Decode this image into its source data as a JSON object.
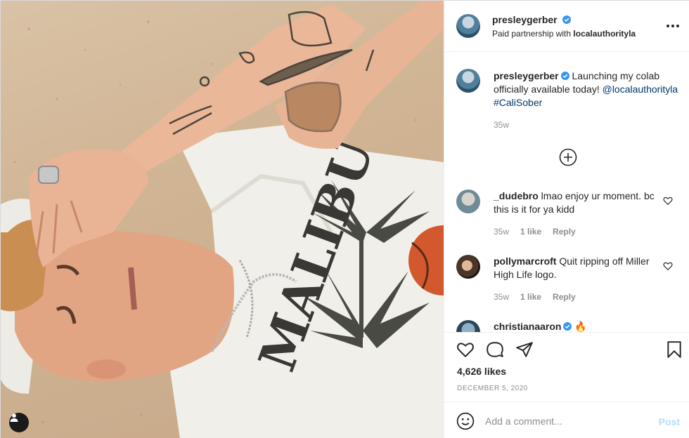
{
  "post": {
    "username": "presleygerber",
    "partnership_prefix": "Paid partnership with",
    "partner": "localauthorityla",
    "caption_text": "Launching my colab officially available today!",
    "caption_mention": "@localauthorityla",
    "caption_hashtag": "#CaliSober",
    "caption_time": "35w",
    "likes": "4,626 likes",
    "date": "DECEMBER 5, 2020",
    "shirt_print": "MALIBU"
  },
  "comments": [
    {
      "username": "_dudebro",
      "text": "lmao enjoy ur moment. bc this is it for ya kidd",
      "time": "35w",
      "likes": "1 like",
      "reply": "Reply"
    },
    {
      "username": "pollymarcroft",
      "text": "Quit ripping off Miller High Life logo.",
      "time": "35w",
      "likes": "1 like",
      "reply": "Reply"
    },
    {
      "username": "christianaaron",
      "text": "🔥"
    }
  ],
  "add_comment": {
    "placeholder": "Add a comment...",
    "post_label": "Post"
  },
  "icons": [
    "verified-badge-icon",
    "more-options-icon",
    "plus-circle-icon",
    "heart-icon",
    "comment-icon",
    "share-icon",
    "bookmark-icon",
    "emoji-icon",
    "user-tag-icon"
  ],
  "colors": {
    "link": "#00376b",
    "verified": "#3897f0",
    "muted": "#8e8e8e",
    "post_disabled": "#b2dffc"
  }
}
